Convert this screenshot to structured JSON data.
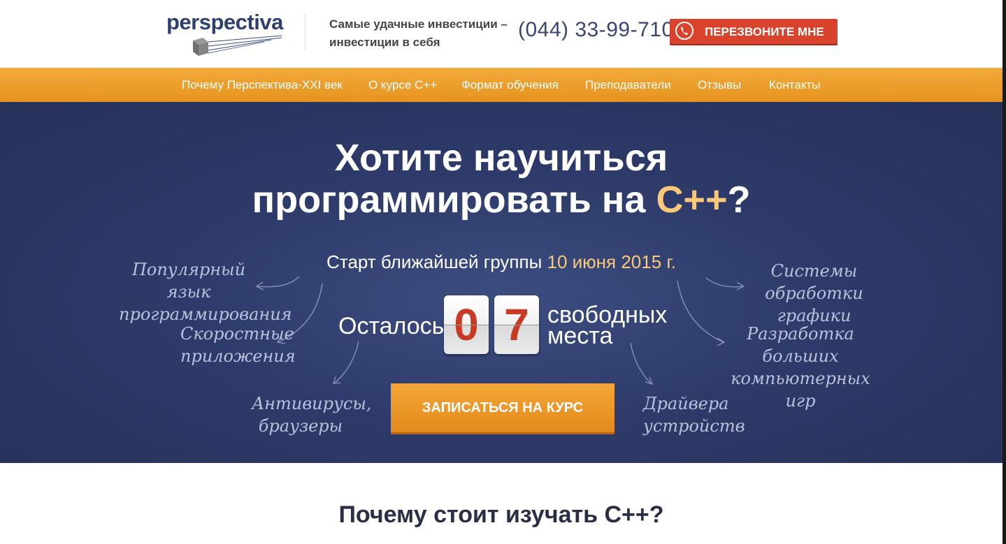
{
  "header": {
    "logo_text": "perspectiva",
    "tagline": "Самые удачные инвестиции – инвестиции в себя",
    "phone": "(044) 33-99-710",
    "callback_label": "ПЕРЕЗВОНИТЕ МНЕ",
    "callback_icon": "phone-icon"
  },
  "nav": {
    "items": [
      {
        "label": "Почему Перспектива-XXI век"
      },
      {
        "label": "О курсе С++"
      },
      {
        "label": "Формат обучения"
      },
      {
        "label": "Преподаватели"
      },
      {
        "label": "Отзывы"
      },
      {
        "label": "Контакты"
      }
    ]
  },
  "hero": {
    "title_line1": "Хотите научиться",
    "title_line2_prefix": "программировать на ",
    "title_accent": "С++",
    "title_suffix": "?",
    "start_prefix": "Старт ближайшей группы ",
    "start_date": "10 июня 2015 г.",
    "remain_label": "Осталось",
    "digits": [
      "0",
      "7"
    ],
    "seats_line1": "свободных",
    "seats_line2": "места",
    "cta_label": "ЗАПИСАТЬСЯ НА КУРС",
    "notes": [
      "Популярный язык программирования",
      "Скоростные приложения",
      "Антивирусы, браузеры",
      "Системы обработки графики",
      "Разработка больших компьютерных игр",
      "Драйвера устройств"
    ]
  },
  "why": {
    "title": "Почему стоит изучать С++?"
  },
  "colors": {
    "nav": "#eda02d",
    "hero": "#2e3b6a",
    "accent": "#f9c878",
    "callback": "#d9422c"
  }
}
